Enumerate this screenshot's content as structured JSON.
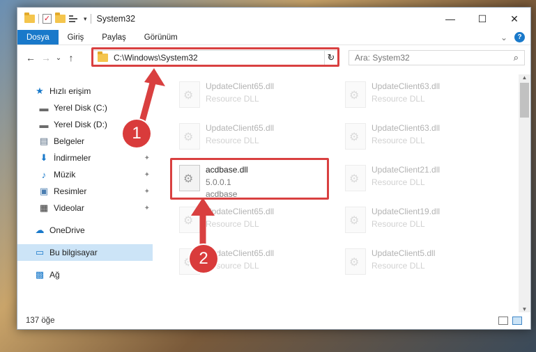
{
  "window": {
    "title": "System32",
    "controls": {
      "minimize": "—",
      "maximize": "☐",
      "close": "✕"
    }
  },
  "ribbon": {
    "tabs": [
      "Dosya",
      "Giriş",
      "Paylaş",
      "Görünüm"
    ],
    "active_tab": "Dosya",
    "expand_caret": "⌄",
    "help": "?"
  },
  "nav": {
    "back": "←",
    "forward": "→",
    "recent": "⌄",
    "up": "↑",
    "address_path": "C:\\Windows\\System32",
    "address_caret": "⌄",
    "refresh": "↻",
    "search_placeholder": "Ara: System32",
    "search_icon": "⌕"
  },
  "sidebar": {
    "items": [
      {
        "label": "Hızlı erişim",
        "icon": "star-icon",
        "glyph": "★",
        "color": "#1979ca",
        "pinned": false
      },
      {
        "label": "Yerel Disk (C:)",
        "icon": "drive-icon",
        "glyph": "▬",
        "color": "#6b6b6b",
        "pinned": true
      },
      {
        "label": "Yerel Disk (D:)",
        "icon": "drive-icon",
        "glyph": "▬",
        "color": "#6b6b6b",
        "pinned": true
      },
      {
        "label": "Belgeler",
        "icon": "document-icon",
        "glyph": "▤",
        "color": "#5b6f86",
        "pinned": true
      },
      {
        "label": "İndirmeler",
        "icon": "download-icon",
        "glyph": "⬇",
        "color": "#1979ca",
        "pinned": true
      },
      {
        "label": "Müzik",
        "icon": "music-icon",
        "glyph": "♪",
        "color": "#1979ca",
        "pinned": true
      },
      {
        "label": "Resimler",
        "icon": "pictures-icon",
        "glyph": "▣",
        "color": "#4a7db0",
        "pinned": true
      },
      {
        "label": "Videolar",
        "icon": "video-icon",
        "glyph": "▦",
        "color": "#333333",
        "pinned": true
      },
      {
        "label": "OneDrive",
        "icon": "cloud-icon",
        "glyph": "☁",
        "color": "#1979ca",
        "pinned": false
      },
      {
        "label": "Bu bilgisayar",
        "icon": "computer-icon",
        "glyph": "▭",
        "color": "#1979ca",
        "pinned": false
      },
      {
        "label": "Ağ",
        "icon": "network-icon",
        "glyph": "▩",
        "color": "#1979ca",
        "pinned": false
      }
    ],
    "selected_item": "Bu bilgisayar",
    "pin_glyph": "📌"
  },
  "files": [
    {
      "name": "UpdateClient65.dll",
      "sub": "Resource DLL",
      "faded": true
    },
    {
      "name": "UpdateClient63.dll",
      "sub": "Resource DLL",
      "faded": true
    },
    {
      "name": "UpdateClient65.dll",
      "sub": "Resource DLL",
      "faded": true
    },
    {
      "name": "UpdateClient63.dll",
      "sub": "Resource DLL",
      "faded": true
    },
    {
      "name": "acdbase.dll",
      "sub": "5.0.0.1",
      "sub2": "acdbase",
      "faded": false
    },
    {
      "name": "UpdateClient21.dll",
      "sub": "Resource DLL",
      "faded": true
    },
    {
      "name": "UpdateClient65.dll",
      "sub": "Resource DLL",
      "faded": true
    },
    {
      "name": "UpdateClient19.dll",
      "sub": "Resource DLL",
      "faded": true
    },
    {
      "name": "UpdateClient65.dll",
      "sub": "Resource DLL",
      "faded": true
    },
    {
      "name": "UpdateClient5.dll",
      "sub": "Resource DLL",
      "faded": true
    }
  ],
  "status": {
    "item_count": "137 öğe"
  },
  "annotations": {
    "badge_1": "1",
    "badge_2": "2",
    "color": "#d94040"
  }
}
